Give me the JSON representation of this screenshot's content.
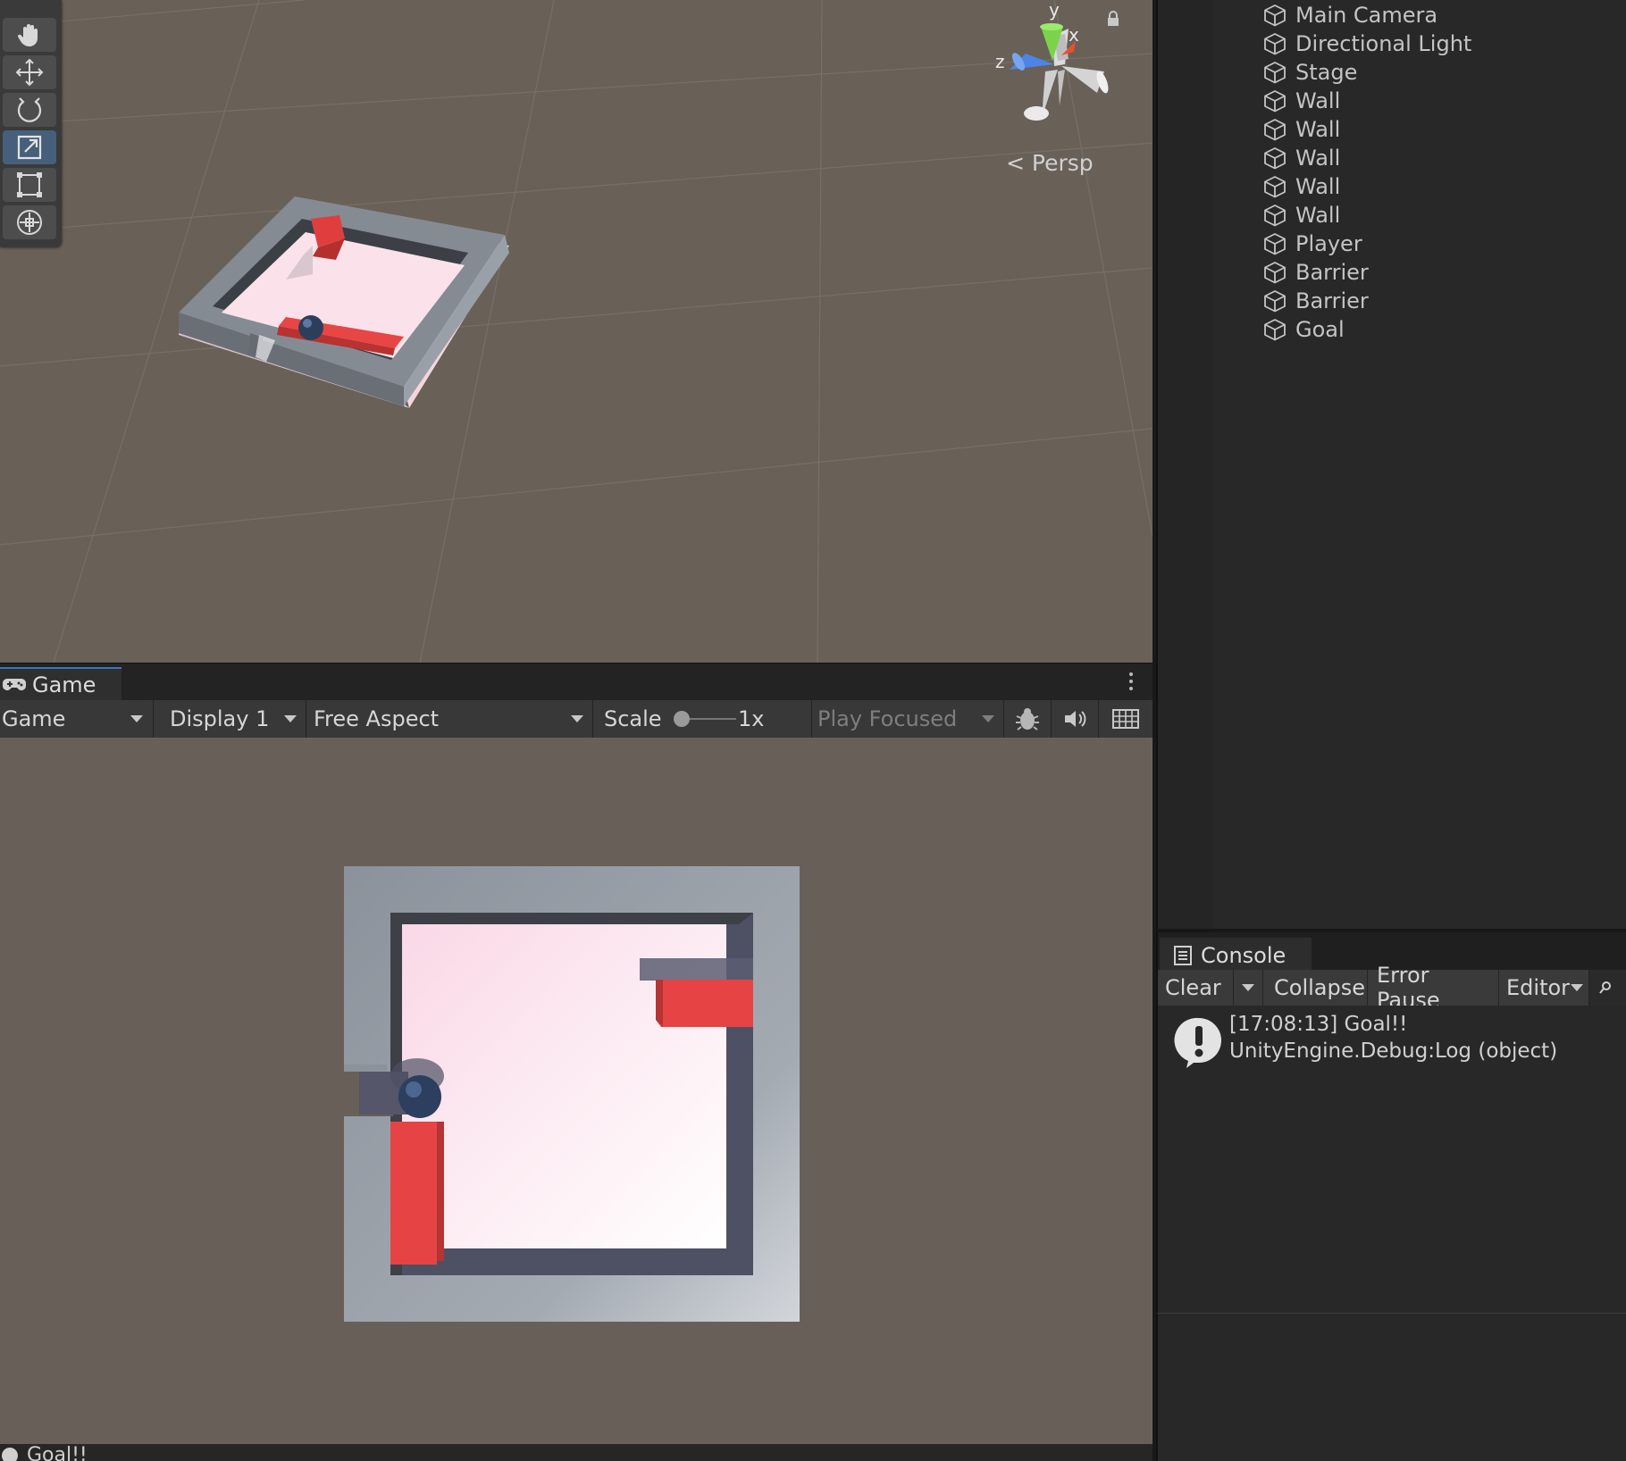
{
  "scene": {
    "camera_mode": "Persp",
    "tools": [
      "hand-tool",
      "move-tool",
      "rotate-tool",
      "scale-tool",
      "rect-tool",
      "transform-tool"
    ],
    "active_tool": "scale-tool",
    "gizmo_axes": {
      "y": "y",
      "x": "x",
      "z": "z"
    }
  },
  "game": {
    "tab_label": "Game",
    "toolbar": {
      "view_mode": "Game",
      "display": "Display 1",
      "aspect": "Free Aspect",
      "scale_label": "Scale",
      "scale_value": "1x",
      "play_mode": "Play Focused"
    },
    "status_bar_text": "Goal!!"
  },
  "hierarchy": {
    "items": [
      "Main Camera",
      "Directional Light",
      "Stage",
      "Wall",
      "Wall",
      "Wall",
      "Wall",
      "Wall",
      "Player",
      "Barrier",
      "Barrier",
      "Goal"
    ]
  },
  "console": {
    "tab_label": "Console",
    "toolbar": {
      "clear": "Clear",
      "collapse": "Collapse",
      "error_pause": "Error Pause",
      "editor": "Editor"
    },
    "entries": [
      {
        "line1": "[17:08:13] Goal!!",
        "line2": "UnityEngine.Debug:Log (object)"
      }
    ]
  },
  "colors": {
    "scene_bg": "#696058",
    "game_bg": "#686058",
    "floor": "#fbe3ee",
    "wall": "#8e959e",
    "barrier": "#e64444",
    "player": "#2c3f5e",
    "accent": "#3a79bb"
  }
}
